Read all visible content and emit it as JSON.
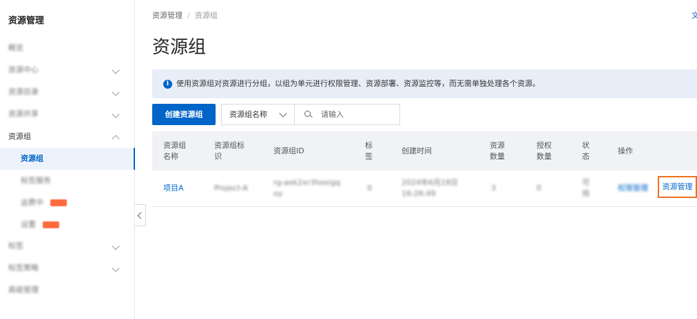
{
  "sidebar": {
    "title": "资源管理",
    "items": [
      {
        "label": "概览"
      },
      {
        "label": "资源中心"
      },
      {
        "label": "资源目录"
      },
      {
        "label": "资源共享"
      },
      {
        "label": "资源组"
      },
      {
        "label": "资源组"
      },
      {
        "label": "标签服务"
      },
      {
        "label": "运费中"
      },
      {
        "label": "设置"
      },
      {
        "label": "标签"
      },
      {
        "label": "标签策略"
      },
      {
        "label": "高级管理"
      }
    ]
  },
  "breadcrumb": {
    "root": "资源管理",
    "sep": "/",
    "current": "资源组"
  },
  "top_right_link": "文",
  "page_title": "资源组",
  "notice": {
    "icon": "info-icon",
    "text": "使用资源组对资源进行分组，以组为单元进行权限管理、资源部署、资源监控等，而无需单独处理各个资源。"
  },
  "toolbar": {
    "create_label": "创建资源组",
    "filter_select": "资源组名称",
    "search_placeholder": "请输入"
  },
  "table": {
    "headers": [
      "资源组\n名称",
      "资源组标\n识",
      "资源组ID",
      "标\n签",
      "创建时间",
      "资源\n数量",
      "授权\n数量",
      "状\n态",
      "操作"
    ],
    "rows": [
      {
        "name": "项目A",
        "identifier": "Project-A",
        "id": "rg-aek2xr3hoxigqoy",
        "tags": "0",
        "created": "2024年6月18日 16:26:49",
        "resource_count": "3",
        "auth_count": "0",
        "status": "可用",
        "action_permission": "权限管理",
        "action_resource": "资源管理"
      }
    ]
  },
  "colors": {
    "accent": "#0064c8",
    "highlight": "#f07020"
  }
}
